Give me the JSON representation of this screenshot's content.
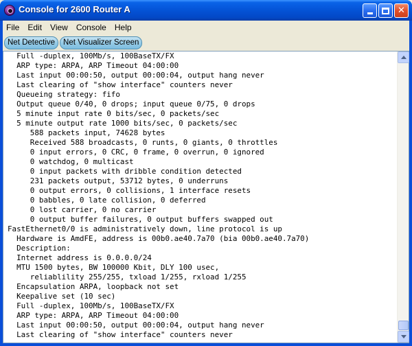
{
  "window": {
    "title": "Console for 2600 Router A",
    "controls": {
      "minimize": "minimize",
      "maximize": "maximize",
      "close": "✕"
    }
  },
  "menu": [
    "File",
    "Edit",
    "View",
    "Console",
    "Help"
  ],
  "toolbar": [
    "Net Detective",
    "Net Visualizer Screen"
  ],
  "console": {
    "lines": [
      "  Full -duplex, 100Mb/s, 100BaseTX/FX",
      "  ARP type: ARPA, ARP Timeout 04:00:00",
      "  Last input 00:00:50, output 00:00:04, output hang never",
      "  Last clearing of \"show interface\" counters never",
      "  Queueing strategy: fifo",
      "  Output queue 0/40, 0 drops; input queue 0/75, 0 drops",
      "  5 minute input rate 0 bits/sec, 0 packets/sec",
      "  5 minute output rate 1000 bits/sec, 0 packets/sec",
      "     588 packets input, 74628 bytes",
      "     Received 588 broadcasts, 0 runts, 0 giants, 0 throttles",
      "     0 input errors, 0 CRC, 0 frame, 0 overrun, 0 ignored",
      "     0 watchdog, 0 multicast",
      "     0 input packets with dribble condition detected",
      "     231 packets output, 53712 bytes, 0 underruns",
      "     0 output errors, 0 collisions, 1 interface resets",
      "     0 babbles, 0 late collision, 0 deferred",
      "     0 lost carrier, 0 no carrier",
      "     0 output buffer failures, 0 output buffers swapped out",
      "FastEthernet0/0 is administratively down, line protocol is up",
      "  Hardware is AmdFE, address is 00b0.ae40.7a70 (bia 00b0.ae40.7a70)",
      "  Description:",
      "  Internet address is 0.0.0.0/24",
      "  MTU 1500 bytes, BW 100000 Kbit, DLY 100 usec,",
      "     reliablility 255/255, txload 1/255, rxload 1/255",
      "  Encapsulation ARPA, loopback not set",
      "  Keepalive set (10 sec)",
      "  Full -duplex, 100Mb/s, 100BaseTX/FX",
      "  ARP type: ARPA, ARP Timeout 04:00:00",
      "  Last input 00:00:50, output 00:00:04, output hang never",
      "  Last clearing of \"show interface\" counters never"
    ]
  },
  "icons": {
    "app": "router-console-icon",
    "scroll_up": "scroll-up-arrow-icon",
    "scroll_down": "scroll-down-arrow-icon"
  },
  "colors": {
    "titlebar": "#0453d6",
    "close_button": "#e0502a",
    "toolbar_button": "#96cbe6",
    "console_bg": "#ffffff"
  }
}
